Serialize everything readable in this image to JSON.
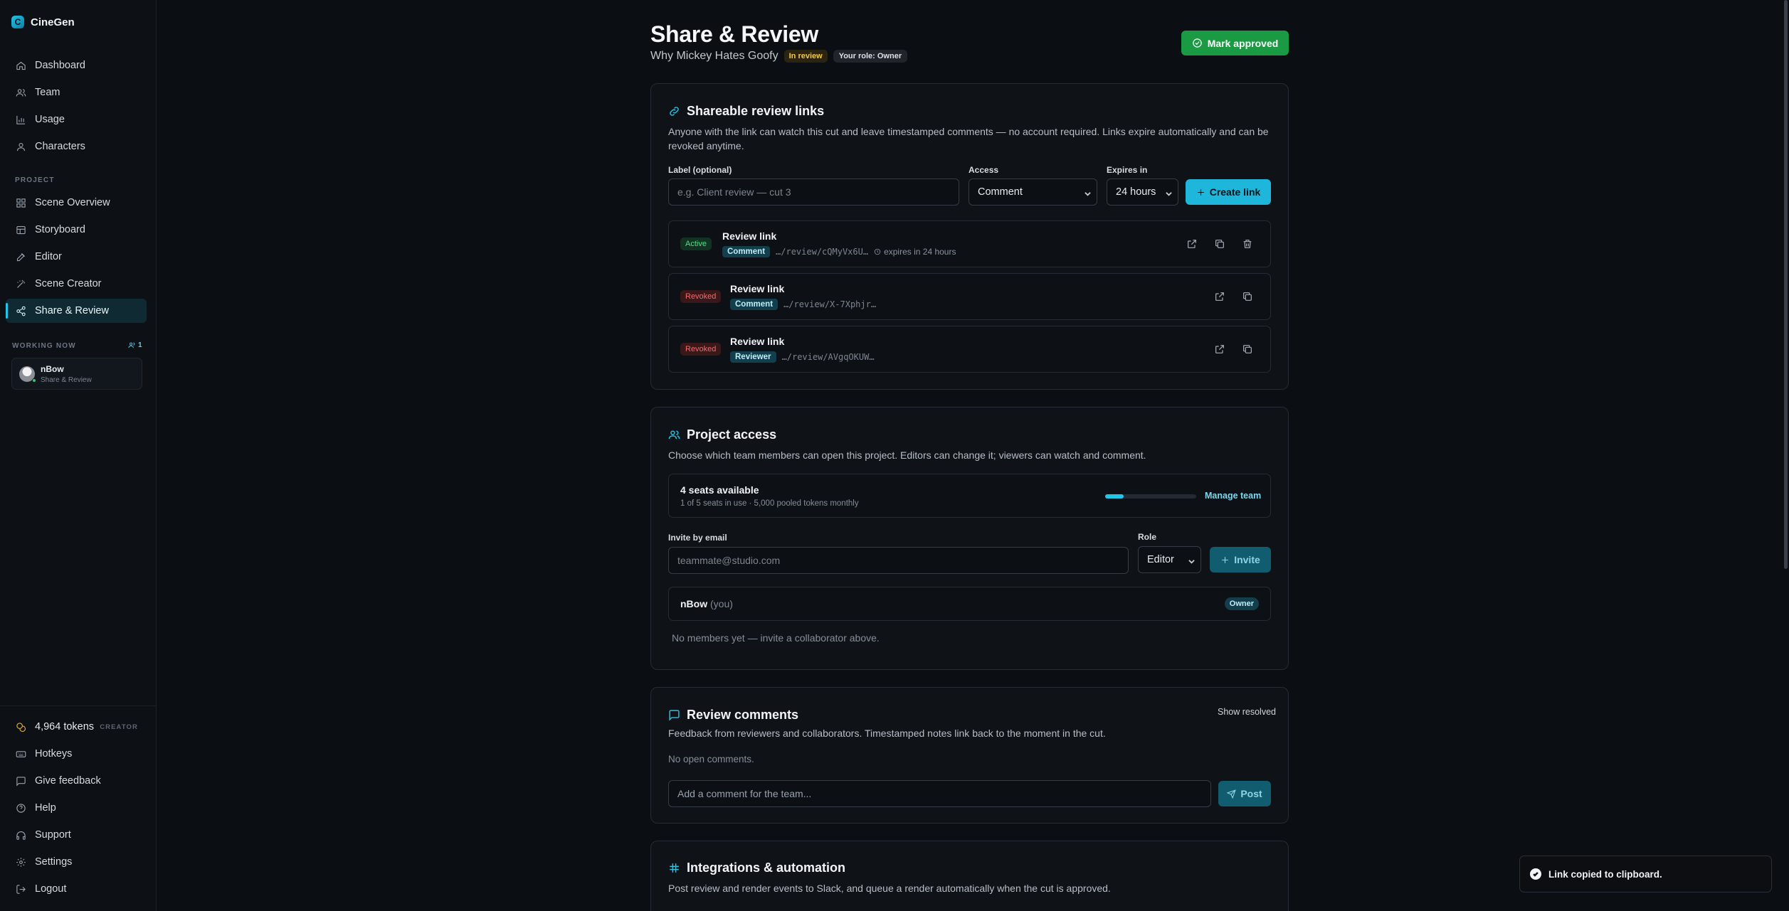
{
  "brand": {
    "name": "CineGen"
  },
  "nav": {
    "dashboard": "Dashboard",
    "team": "Team",
    "usage": "Usage",
    "characters": "Characters",
    "project_label": "PROJECT",
    "scene_overview": "Scene Overview",
    "storyboard": "Storyboard",
    "editor": "Editor",
    "scene_creator": "Scene Creator",
    "share_review": "Share & Review"
  },
  "working_now": {
    "label": "WORKING NOW",
    "count": "1",
    "user_name": "nBow",
    "user_location": "Share & Review"
  },
  "footer_nav": {
    "tokens": "4,964 tokens",
    "tier": "CREATOR",
    "hotkeys": "Hotkeys",
    "feedback": "Give feedback",
    "help": "Help",
    "support": "Support",
    "settings": "Settings",
    "logout": "Logout"
  },
  "header": {
    "title": "Share & Review",
    "project_name": "Why Mickey Hates Goofy",
    "status": "In review",
    "role": "Your role: Owner",
    "approve_label": "Mark approved"
  },
  "review_links": {
    "title": "Shareable review links",
    "description": "Anyone with the link can watch this cut and leave timestamped comments — no account required. Links expire automatically and can be revoked anytime.",
    "label_field": "Label (optional)",
    "label_placeholder": "e.g. Client review — cut 3",
    "access_label": "Access",
    "access_value": "Comment",
    "expires_label": "Expires in",
    "expires_value": "24 hours",
    "create_label": "Create link",
    "links": [
      {
        "status": "Active",
        "title": "Review link",
        "access": "Comment",
        "url": "…/review/cQMyVx6U…",
        "expires": "expires in 24 hours"
      },
      {
        "status": "Revoked",
        "title": "Review link",
        "access": "Comment",
        "url": "…/review/X-7Xphjr…"
      },
      {
        "status": "Revoked",
        "title": "Review link",
        "access": "Reviewer",
        "url": "…/review/AVgqOKUW…"
      }
    ]
  },
  "project_access": {
    "title": "Project access",
    "description": "Choose which team members can open this project. Editors can change it; viewers can watch and comment.",
    "seats_title": "4 seats available",
    "seats_sub": "1 of 5 seats in use · 5,000 pooled tokens monthly",
    "seats_used_fraction": 0.2,
    "manage_label": "Manage team",
    "invite_label": "Invite by email",
    "invite_placeholder": "teammate@studio.com",
    "role_label": "Role",
    "role_value": "Editor",
    "invite_button": "Invite",
    "member_name": "nBow",
    "member_you": "(you)",
    "member_role": "Owner",
    "empty_note": "No members yet — invite a collaborator above."
  },
  "review_comments": {
    "title": "Review comments",
    "show_resolved": "Show resolved",
    "description": "Feedback from reviewers and collaborators. Timestamped notes link back to the moment in the cut.",
    "empty": "No open comments.",
    "comment_placeholder": "Add a comment for the team...",
    "post_label": "Post"
  },
  "integrations": {
    "title": "Integrations & automation",
    "description": "Post review and render events to Slack, and queue a render automatically when the cut is approved."
  },
  "toast": {
    "message": "Link copied to clipboard."
  }
}
